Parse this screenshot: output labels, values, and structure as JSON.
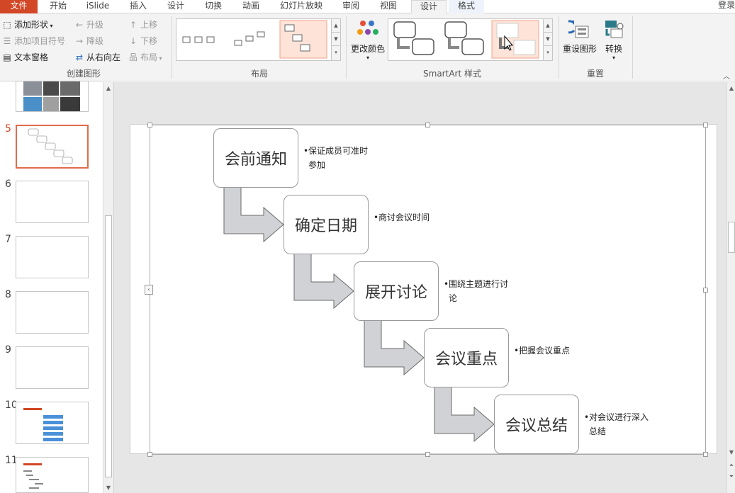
{
  "tabs": [
    {
      "label": "文件",
      "state": "file"
    },
    {
      "label": "开始",
      "state": ""
    },
    {
      "label": "iSlide",
      "state": ""
    },
    {
      "label": "插入",
      "state": ""
    },
    {
      "label": "设计",
      "state": ""
    },
    {
      "label": "切换",
      "state": ""
    },
    {
      "label": "动画",
      "state": ""
    },
    {
      "label": "幻灯片放映",
      "state": ""
    },
    {
      "label": "审阅",
      "state": ""
    },
    {
      "label": "视图",
      "state": ""
    },
    {
      "label": "设计",
      "state": "active"
    },
    {
      "label": "格式",
      "state": ""
    }
  ],
  "login": "登录",
  "ribbon": {
    "create": {
      "add_shape": "添加形状",
      "add_bullet": "添加项目符号",
      "text_pane": "文本窗格",
      "promote": "升级",
      "demote": "降级",
      "right_to_left": "从右向左",
      "move_up": "上移",
      "move_down": "下移",
      "layout": "布局",
      "group_label": "创建图形"
    },
    "layout_group_label": "布局",
    "change_colors": "更改颜色",
    "styles_group_label": "SmartArt 样式",
    "reset_graphic": "重设图形",
    "convert": "转换",
    "reset_group_label": "重置"
  },
  "slides": [
    {
      "num": "",
      "kind": "photos"
    },
    {
      "num": "5",
      "kind": "smartart",
      "active": true
    },
    {
      "num": "6",
      "kind": "blank"
    },
    {
      "num": "7",
      "kind": "blank"
    },
    {
      "num": "8",
      "kind": "blank"
    },
    {
      "num": "9",
      "kind": "blank"
    },
    {
      "num": "10",
      "kind": "list"
    },
    {
      "num": "11",
      "kind": "outline"
    }
  ],
  "smartart": {
    "steps": [
      {
        "title": "会前通知",
        "note": "保证成员可准时参加"
      },
      {
        "title": "确定日期",
        "note": "商讨会议时间"
      },
      {
        "title": "展开讨论",
        "note": "围绕主题进行讨论"
      },
      {
        "title": "会议重点",
        "note": "把握会议重点"
      },
      {
        "title": "会议总结",
        "note": "对会议进行深入总结"
      }
    ]
  },
  "colors": {
    "file_tab": "#d24726",
    "accent": "#e36c4a",
    "arrow_fill": "#d0d2d6",
    "arrow_stroke": "#6b6b6b"
  }
}
